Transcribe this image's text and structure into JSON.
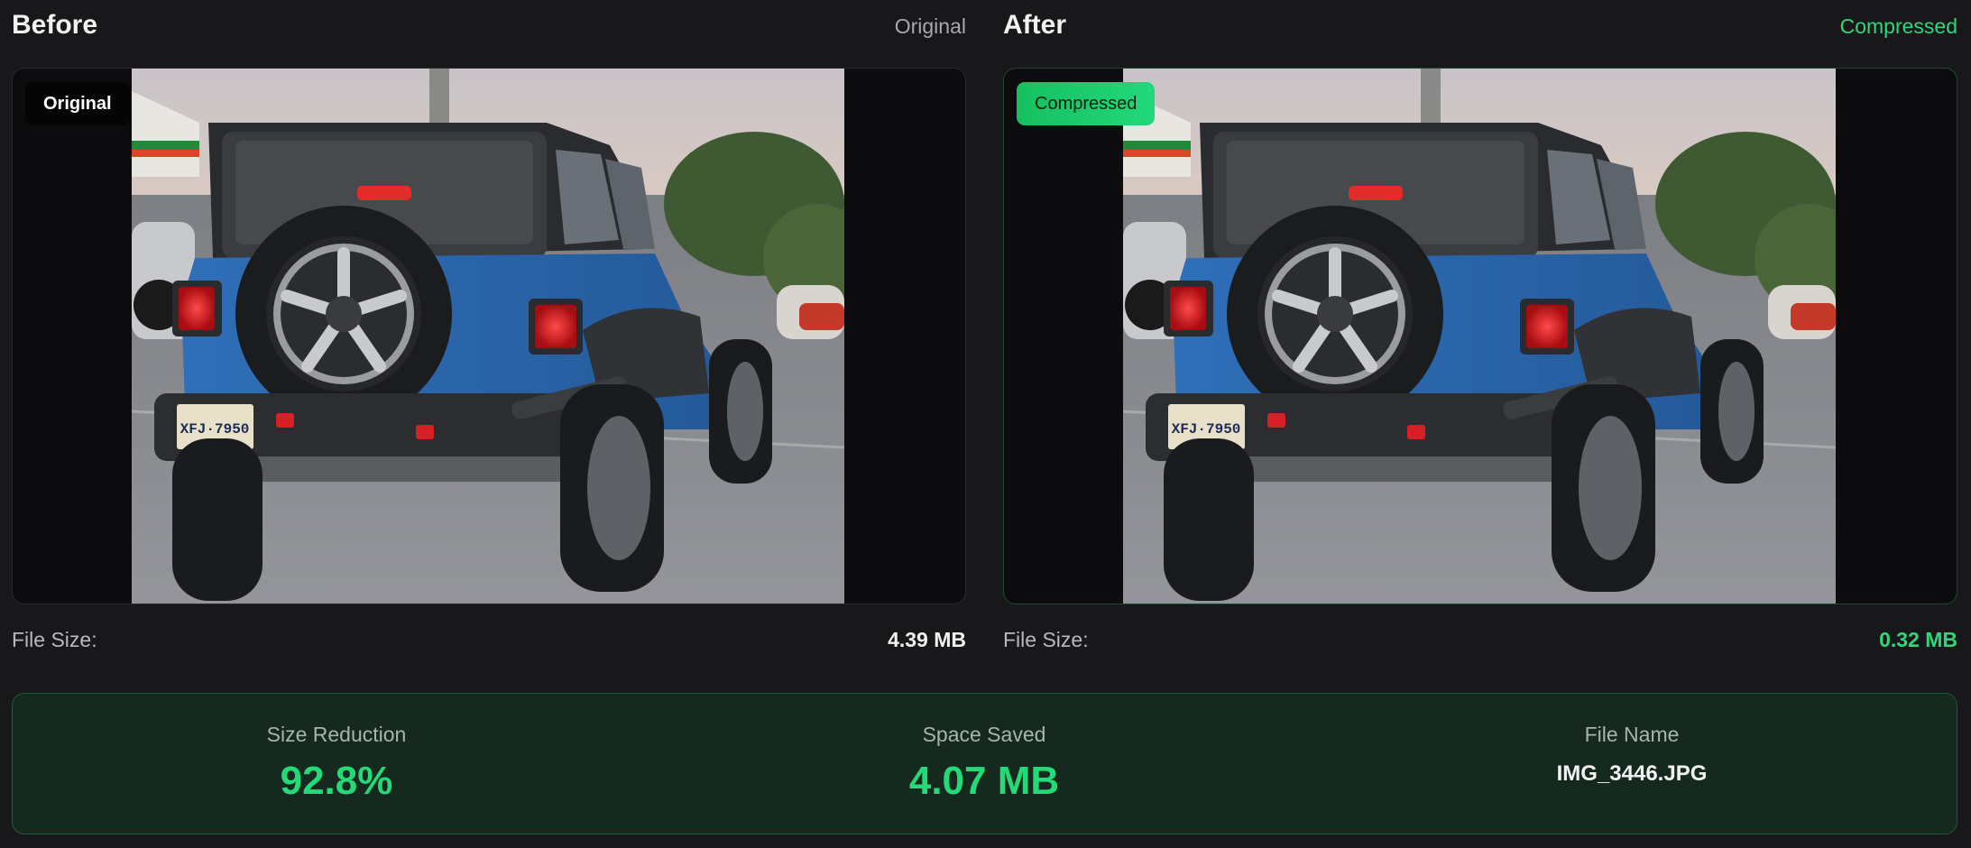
{
  "before": {
    "title": "Before",
    "tag": "Original",
    "badge": "Original",
    "file_size_label": "File Size:",
    "file_size_value": "4.39 MB",
    "image_alt": "Blue Jeep Wrangler rear view in parking lot"
  },
  "after": {
    "title": "After",
    "tag": "Compressed",
    "badge": "Compressed",
    "file_size_label": "File Size:",
    "file_size_value": "0.32 MB",
    "image_alt": "Compressed blue Jeep Wrangler rear view"
  },
  "stats": {
    "size_reduction_label": "Size Reduction",
    "size_reduction_value": "92.8%",
    "space_saved_label": "Space Saved",
    "space_saved_value": "4.07 MB",
    "file_name_label": "File Name",
    "file_name_value": "IMG_3446.JPG"
  },
  "colors": {
    "background": "#18181a",
    "accent_green": "#22d87a",
    "stats_panel": "#15291f"
  }
}
